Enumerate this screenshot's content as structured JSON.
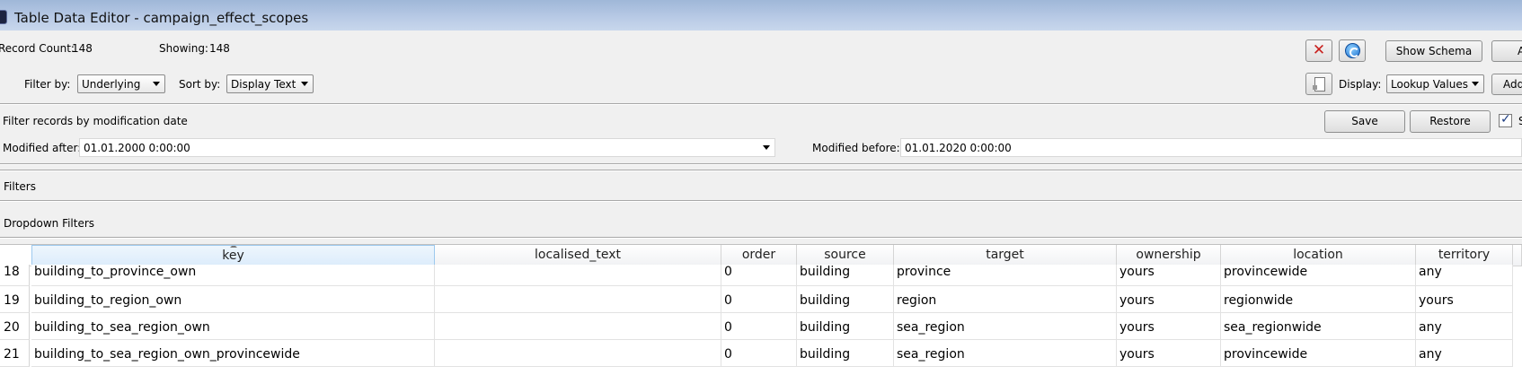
{
  "window": {
    "title": "Table Data Editor - campaign_effect_scopes"
  },
  "toolbar": {
    "record_count_label": "Record Count:",
    "record_count": "148",
    "showing_label": "Showing:",
    "showing": "148",
    "filter_by_label": "Filter by:",
    "filter_by_value": "Underlying",
    "sort_by_label": "Sort by:",
    "sort_by_value": "Display Text",
    "display_label": "Display:",
    "display_value": "Lookup Values",
    "show_schema_label": "Show Schema",
    "add_label": "Add",
    "a_label": "A"
  },
  "date_filter": {
    "title": "Filter records by modification date",
    "modified_after_label": "Modified after:",
    "modified_after_value": "01.01.2000 0:00:00",
    "modified_before_label": "Modified before:",
    "modified_before_value": "01.01.2020 0:00:00",
    "save_label": "Save",
    "restore_label": "Restore",
    "checkbox_label": "S"
  },
  "sections": {
    "filters": "Filters",
    "dropdown_filters": "Dropdown Filters"
  },
  "table": {
    "columns": [
      "key",
      "localised_text",
      "order",
      "source",
      "target",
      "ownership",
      "location",
      "territory"
    ],
    "rows": [
      {
        "num": "18",
        "cells": [
          "building_to_province_own",
          "",
          "0",
          "building",
          "province",
          "yours",
          "provincewide",
          "any"
        ]
      },
      {
        "num": "19",
        "cells": [
          "building_to_region_own",
          "",
          "0",
          "building",
          "region",
          "yours",
          "regionwide",
          "yours"
        ]
      },
      {
        "num": "20",
        "cells": [
          "building_to_sea_region_own",
          "",
          "0",
          "building",
          "sea_region",
          "yours",
          "sea_regionwide",
          "any"
        ]
      },
      {
        "num": "21",
        "cells": [
          "building_to_sea_region_own_provincewide",
          "",
          "0",
          "building",
          "sea_region",
          "yours",
          "provincewide",
          "any"
        ]
      }
    ]
  },
  "icons": {
    "app": "table-editor-icon",
    "delete": "delete-x-icon",
    "refresh": "refresh-icon",
    "document": "document-icon"
  }
}
